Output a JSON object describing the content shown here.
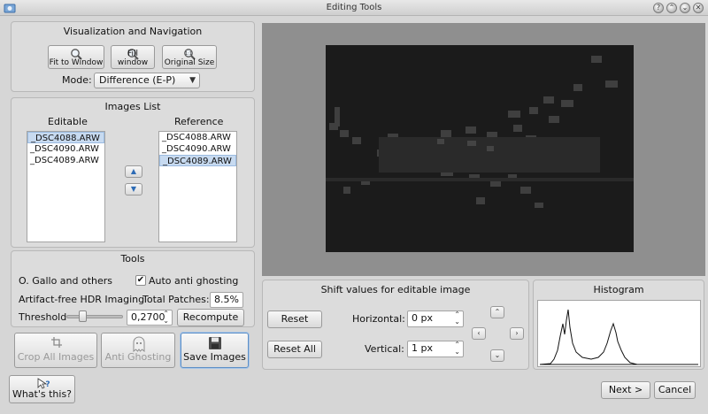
{
  "window": {
    "title": "Editing Tools",
    "buttons": [
      "?",
      "⌃",
      "⌄",
      "✕"
    ]
  },
  "visualization": {
    "title": "Visualization and Navigation",
    "fit_label": "Fit to Window",
    "fill_label": "Fill window",
    "original_label": "Original Size",
    "mode_label": "Mode:",
    "mode_value": "Difference (E-P)"
  },
  "images_list": {
    "title": "Images List",
    "editable_label": "Editable",
    "reference_label": "Reference",
    "editable": [
      "_DSC4088.ARW",
      "_DSC4090.ARW",
      "_DSC4089.ARW"
    ],
    "reference": [
      "_DSC4088.ARW",
      "_DSC4090.ARW",
      "_DSC4089.ARW"
    ]
  },
  "tools": {
    "title": "Tools",
    "author": "O. Gallo and others",
    "auto_anti_ghosting_label": "Auto anti ghosting",
    "auto_anti_ghosting_checked": true,
    "algorithm": "Artifact-free HDR Imaging",
    "total_patches_label": "Total Patches:",
    "total_patches_value": "8.5%",
    "threshold_label": "Threshold",
    "threshold_value": "0,2700",
    "threshold_fraction": 0.25,
    "recompute_label": "Recompute"
  },
  "actions": {
    "crop_label": "Crop All Images",
    "anti_ghosting_label": "Anti Ghosting",
    "save_label": "Save Images"
  },
  "shift": {
    "title": "Shift values for editable image",
    "reset_label": "Reset",
    "reset_all_label": "Reset All",
    "horizontal_label": "Horizontal:",
    "horizontal_value": "0 px",
    "vertical_label": "Vertical:",
    "vertical_value": "1 px"
  },
  "histogram": {
    "title": "Histogram"
  },
  "footer": {
    "whats_this_label": "What's this?",
    "next_label": "Next >",
    "cancel_label": "Cancel"
  },
  "colors": {
    "selection": "#c7daf0",
    "preview_bg": "#8f8f8f",
    "image_bg": "#1b1b1b"
  }
}
